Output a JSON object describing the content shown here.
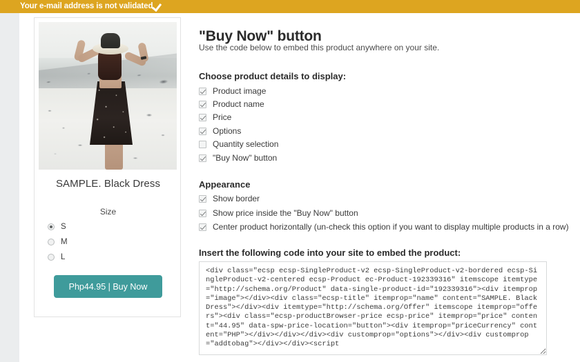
{
  "notice": {
    "text": "Your e-mail address is not validated",
    "icon": "checkmark-icon",
    "background_color": "#dda520",
    "text_color": "#ffffff"
  },
  "header": {
    "title": "\"Buy Now\" button",
    "subtitle": "Use the code below to embed this product anywhere on your site."
  },
  "product_preview": {
    "image_alt": "product-photo-woman-in-black-floral-dress-on-beach",
    "title": "SAMPLE. Black Dress",
    "option_group_label": "Size",
    "sizes": [
      {
        "label": "S",
        "selected": true
      },
      {
        "label": "M",
        "selected": false
      },
      {
        "label": "L",
        "selected": false
      }
    ],
    "buy_button_label": "Php44.95 | Buy Now",
    "buy_button_color": "#3f9b9b"
  },
  "details_section": {
    "heading": "Choose product details to display:",
    "options": [
      {
        "label": "Product image",
        "checked": true
      },
      {
        "label": "Product name",
        "checked": true
      },
      {
        "label": "Price",
        "checked": true
      },
      {
        "label": "Options",
        "checked": true
      },
      {
        "label": "Quantity selection",
        "checked": false
      },
      {
        "label": "\"Buy Now\" button",
        "checked": true
      }
    ]
  },
  "appearance_section": {
    "heading": "Appearance",
    "options": [
      {
        "label": "Show border",
        "checked": true
      },
      {
        "label": "Show price inside the \"Buy Now\" button",
        "checked": true
      },
      {
        "label": "Center product horizontally (un-check this option if you want to display multiple products in a row)",
        "checked": true
      }
    ]
  },
  "embed_section": {
    "heading": "Insert the following code into your site to embed the product:",
    "code": "<div class=\"ecsp ecsp-SingleProduct-v2 ecsp-SingleProduct-v2-bordered ecsp-SingleProduct-v2-centered ecsp-Product ec-Product-192339316\" itemscope itemtype=\"http://schema.org/Product\" data-single-product-id=\"192339316\"><div itemprop=\"image\"></div><div class=\"ecsp-title\" itemprop=\"name\" content=\"SAMPLE. Black Dress\"></div><div itemtype=\"http://schema.org/Offer\" itemscope itemprop=\"offers\"><div class=\"ecsp-productBrowser-price ecsp-price\" itemprop=\"price\" content=\"44.95\" data-spw-price-location=\"button\"><div itemprop=\"priceCurrency\" content=\"PHP\"></div></div></div><div customprop=\"options\"></div><div customprop=\"addtobag\"></div></div><script "
  }
}
